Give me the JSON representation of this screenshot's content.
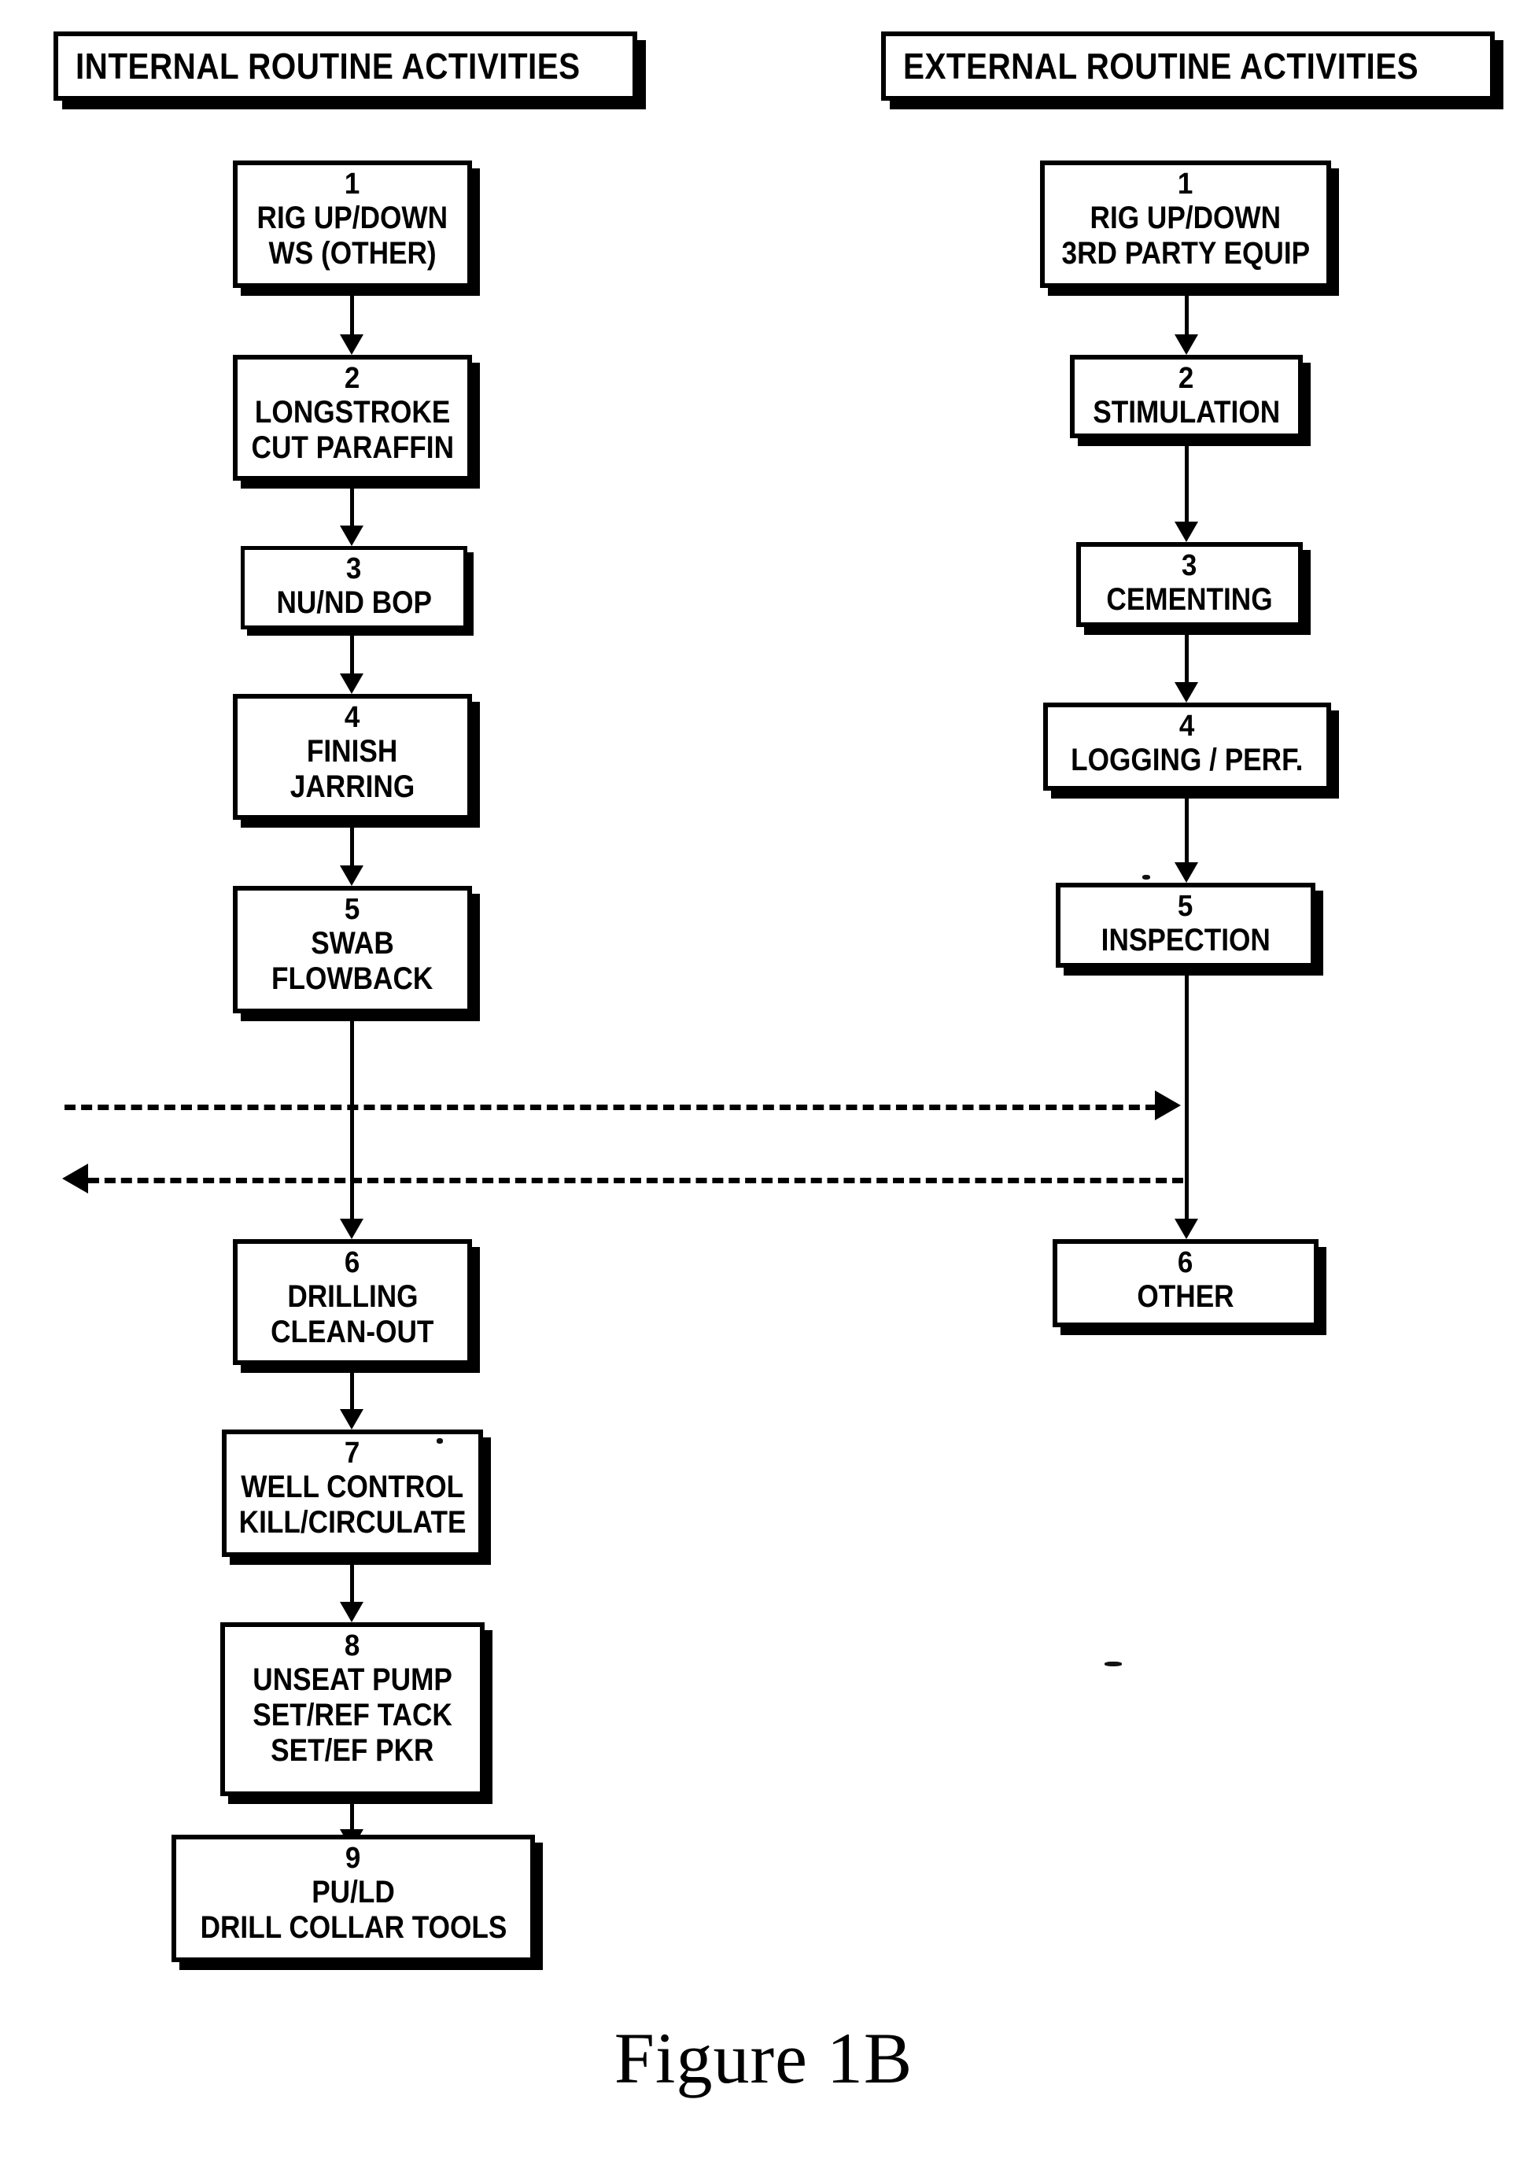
{
  "figure": {
    "caption": "Figure 1B"
  },
  "columns": [
    {
      "id": "internal",
      "header": "INTERNAL ROUTINE ACTIVITIES",
      "steps": [
        {
          "num": "1",
          "lines": [
            "RIG UP/DOWN",
            "WS (OTHER)"
          ]
        },
        {
          "num": "2",
          "lines": [
            "LONGSTROKE",
            "CUT PARAFFIN"
          ]
        },
        {
          "num": "3",
          "lines": [
            "NU/ND BOP"
          ]
        },
        {
          "num": "4",
          "lines": [
            "FINISH",
            "JARRING"
          ]
        },
        {
          "num": "5",
          "lines": [
            "SWAB",
            "FLOWBACK"
          ]
        },
        {
          "num": "6",
          "lines": [
            "DRILLING",
            "CLEAN-OUT"
          ]
        },
        {
          "num": "7",
          "lines": [
            "WELL CONTROL",
            "KILL/CIRCULATE"
          ]
        },
        {
          "num": "8",
          "lines": [
            "UNSEAT PUMP",
            "SET/REF TACK",
            "SET/EF PKR"
          ]
        },
        {
          "num": "9",
          "lines": [
            "PU/LD",
            "DRILL COLLAR TOOLS"
          ]
        }
      ]
    },
    {
      "id": "external",
      "header": "EXTERNAL ROUTINE ACTIVITIES",
      "steps": [
        {
          "num": "1",
          "lines": [
            "RIG UP/DOWN",
            "3RD PARTY EQUIP"
          ]
        },
        {
          "num": "2",
          "lines": [
            "STIMULATION"
          ]
        },
        {
          "num": "3",
          "lines": [
            "CEMENTING"
          ]
        },
        {
          "num": "4",
          "lines": [
            "LOGGING / PERF."
          ]
        },
        {
          "num": "5",
          "lines": [
            "INSPECTION"
          ]
        },
        {
          "num": "6",
          "lines": [
            "OTHER"
          ]
        }
      ]
    }
  ],
  "cross_links": [
    {
      "id": "internal-to-external",
      "direction": "right"
    },
    {
      "id": "external-to-internal",
      "direction": "left"
    }
  ],
  "colors": {
    "ink": "#000000",
    "paper": "#ffffff"
  }
}
